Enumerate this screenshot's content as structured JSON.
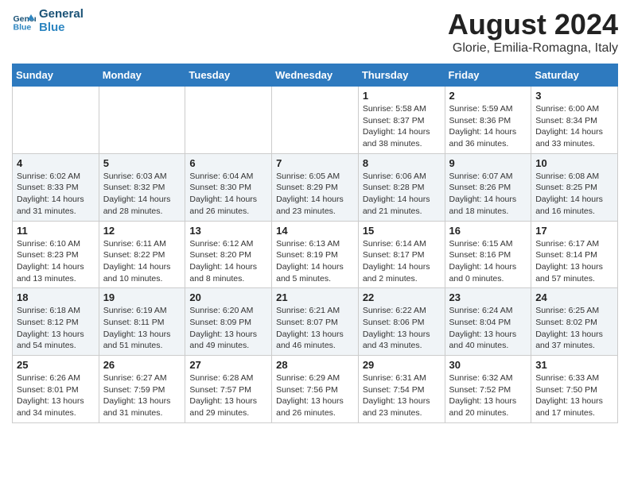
{
  "header": {
    "logo_line1": "General",
    "logo_line2": "Blue",
    "month_year": "August 2024",
    "location": "Glorie, Emilia-Romagna, Italy"
  },
  "days_of_week": [
    "Sunday",
    "Monday",
    "Tuesday",
    "Wednesday",
    "Thursday",
    "Friday",
    "Saturday"
  ],
  "weeks": [
    [
      {
        "day": "",
        "info": ""
      },
      {
        "day": "",
        "info": ""
      },
      {
        "day": "",
        "info": ""
      },
      {
        "day": "",
        "info": ""
      },
      {
        "day": "1",
        "info": "Sunrise: 5:58 AM\nSunset: 8:37 PM\nDaylight: 14 hours\nand 38 minutes."
      },
      {
        "day": "2",
        "info": "Sunrise: 5:59 AM\nSunset: 8:36 PM\nDaylight: 14 hours\nand 36 minutes."
      },
      {
        "day": "3",
        "info": "Sunrise: 6:00 AM\nSunset: 8:34 PM\nDaylight: 14 hours\nand 33 minutes."
      }
    ],
    [
      {
        "day": "4",
        "info": "Sunrise: 6:02 AM\nSunset: 8:33 PM\nDaylight: 14 hours\nand 31 minutes."
      },
      {
        "day": "5",
        "info": "Sunrise: 6:03 AM\nSunset: 8:32 PM\nDaylight: 14 hours\nand 28 minutes."
      },
      {
        "day": "6",
        "info": "Sunrise: 6:04 AM\nSunset: 8:30 PM\nDaylight: 14 hours\nand 26 minutes."
      },
      {
        "day": "7",
        "info": "Sunrise: 6:05 AM\nSunset: 8:29 PM\nDaylight: 14 hours\nand 23 minutes."
      },
      {
        "day": "8",
        "info": "Sunrise: 6:06 AM\nSunset: 8:28 PM\nDaylight: 14 hours\nand 21 minutes."
      },
      {
        "day": "9",
        "info": "Sunrise: 6:07 AM\nSunset: 8:26 PM\nDaylight: 14 hours\nand 18 minutes."
      },
      {
        "day": "10",
        "info": "Sunrise: 6:08 AM\nSunset: 8:25 PM\nDaylight: 14 hours\nand 16 minutes."
      }
    ],
    [
      {
        "day": "11",
        "info": "Sunrise: 6:10 AM\nSunset: 8:23 PM\nDaylight: 14 hours\nand 13 minutes."
      },
      {
        "day": "12",
        "info": "Sunrise: 6:11 AM\nSunset: 8:22 PM\nDaylight: 14 hours\nand 10 minutes."
      },
      {
        "day": "13",
        "info": "Sunrise: 6:12 AM\nSunset: 8:20 PM\nDaylight: 14 hours\nand 8 minutes."
      },
      {
        "day": "14",
        "info": "Sunrise: 6:13 AM\nSunset: 8:19 PM\nDaylight: 14 hours\nand 5 minutes."
      },
      {
        "day": "15",
        "info": "Sunrise: 6:14 AM\nSunset: 8:17 PM\nDaylight: 14 hours\nand 2 minutes."
      },
      {
        "day": "16",
        "info": "Sunrise: 6:15 AM\nSunset: 8:16 PM\nDaylight: 14 hours\nand 0 minutes."
      },
      {
        "day": "17",
        "info": "Sunrise: 6:17 AM\nSunset: 8:14 PM\nDaylight: 13 hours\nand 57 minutes."
      }
    ],
    [
      {
        "day": "18",
        "info": "Sunrise: 6:18 AM\nSunset: 8:12 PM\nDaylight: 13 hours\nand 54 minutes."
      },
      {
        "day": "19",
        "info": "Sunrise: 6:19 AM\nSunset: 8:11 PM\nDaylight: 13 hours\nand 51 minutes."
      },
      {
        "day": "20",
        "info": "Sunrise: 6:20 AM\nSunset: 8:09 PM\nDaylight: 13 hours\nand 49 minutes."
      },
      {
        "day": "21",
        "info": "Sunrise: 6:21 AM\nSunset: 8:07 PM\nDaylight: 13 hours\nand 46 minutes."
      },
      {
        "day": "22",
        "info": "Sunrise: 6:22 AM\nSunset: 8:06 PM\nDaylight: 13 hours\nand 43 minutes."
      },
      {
        "day": "23",
        "info": "Sunrise: 6:24 AM\nSunset: 8:04 PM\nDaylight: 13 hours\nand 40 minutes."
      },
      {
        "day": "24",
        "info": "Sunrise: 6:25 AM\nSunset: 8:02 PM\nDaylight: 13 hours\nand 37 minutes."
      }
    ],
    [
      {
        "day": "25",
        "info": "Sunrise: 6:26 AM\nSunset: 8:01 PM\nDaylight: 13 hours\nand 34 minutes."
      },
      {
        "day": "26",
        "info": "Sunrise: 6:27 AM\nSunset: 7:59 PM\nDaylight: 13 hours\nand 31 minutes."
      },
      {
        "day": "27",
        "info": "Sunrise: 6:28 AM\nSunset: 7:57 PM\nDaylight: 13 hours\nand 29 minutes."
      },
      {
        "day": "28",
        "info": "Sunrise: 6:29 AM\nSunset: 7:56 PM\nDaylight: 13 hours\nand 26 minutes."
      },
      {
        "day": "29",
        "info": "Sunrise: 6:31 AM\nSunset: 7:54 PM\nDaylight: 13 hours\nand 23 minutes."
      },
      {
        "day": "30",
        "info": "Sunrise: 6:32 AM\nSunset: 7:52 PM\nDaylight: 13 hours\nand 20 minutes."
      },
      {
        "day": "31",
        "info": "Sunrise: 6:33 AM\nSunset: 7:50 PM\nDaylight: 13 hours\nand 17 minutes."
      }
    ]
  ]
}
